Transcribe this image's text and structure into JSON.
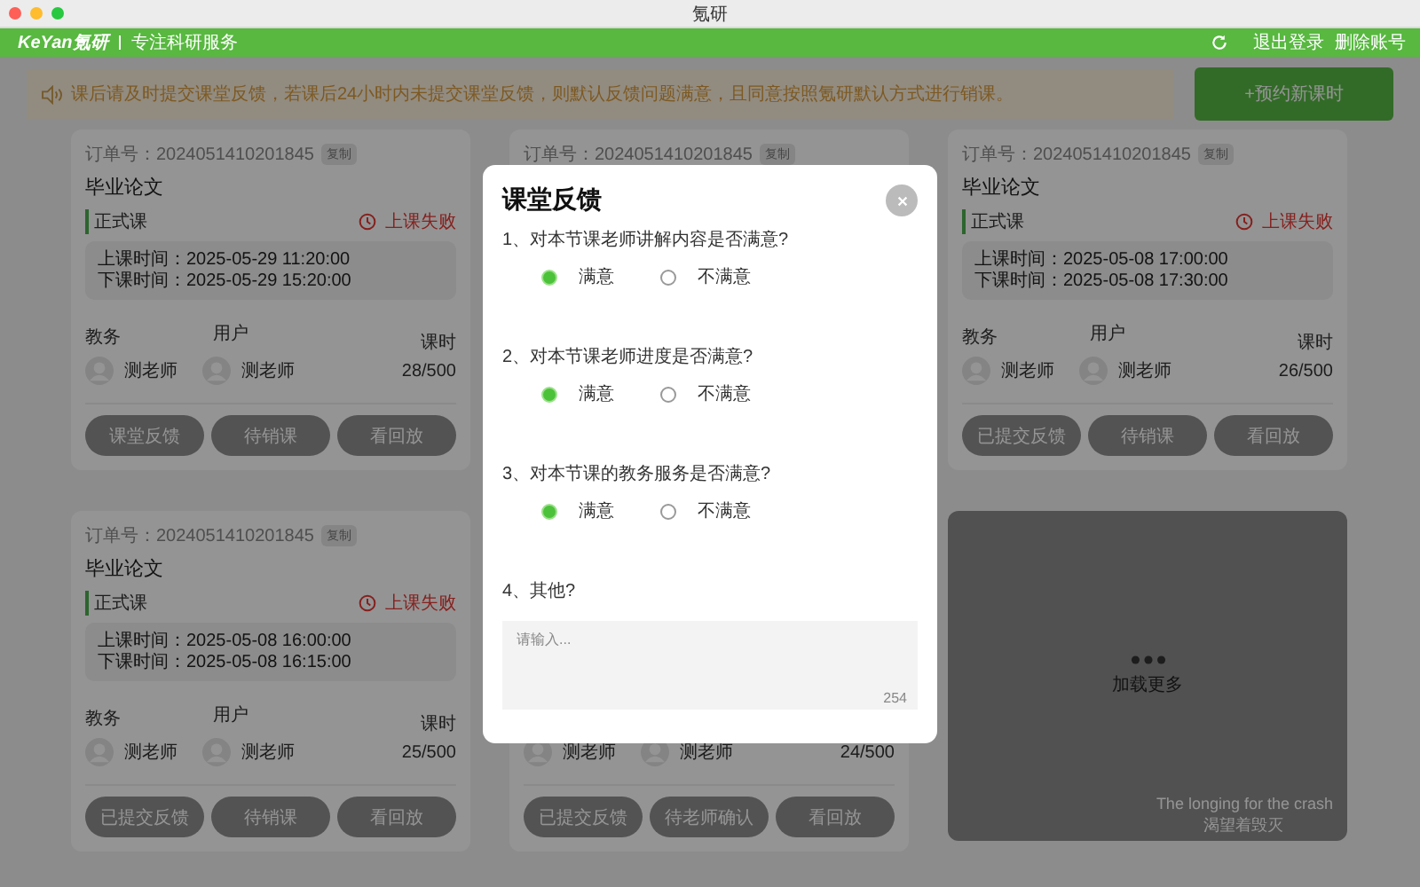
{
  "window": {
    "title": "氪研"
  },
  "nav": {
    "logo": "KeYan氪研",
    "tagline": "专注科研服务",
    "actions": [
      "退出登录",
      "删除账号"
    ]
  },
  "notice": {
    "text": "课后请及时提交课堂反馈，若课后24小时内未提交课堂反馈，则默认反馈问题满意，且同意按照氪研默认方式进行销课。"
  },
  "new_button": "+预约新课时",
  "cards": [
    {
      "kind": "order",
      "order_label": "订单号：",
      "order_no": "2024051410201845",
      "copy": "复制",
      "title": "毕业论文",
      "type": "正式课",
      "status": "上课失败",
      "start": "上课时间：2025-05-29 11:20:00",
      "end": "下课时间：2025-05-29 15:20:00",
      "staff_label": "教务",
      "user_label": "用户",
      "hours_label": "课时",
      "staff_name": "测老师",
      "user_name": "测老师",
      "hours": "28/500",
      "buttons": [
        "课堂反馈",
        "待销课",
        "看回放"
      ]
    },
    {
      "kind": "order",
      "order_label": "订单号：",
      "order_no": "2024051410201845",
      "copy": "复制"
    },
    {
      "kind": "order",
      "order_label": "订单号：",
      "order_no": "2024051410201845",
      "copy": "复制",
      "title": "毕业论文",
      "type": "正式课",
      "status": "上课失败",
      "start": "上课时间：2025-05-08 17:00:00",
      "end": "下课时间：2025-05-08 17:30:00",
      "staff_label": "教务",
      "user_label": "用户",
      "hours_label": "课时",
      "staff_name": "测老师",
      "user_name": "测老师",
      "hours": "26/500",
      "buttons": [
        "已提交反馈",
        "待销课",
        "看回放"
      ]
    },
    {
      "kind": "order",
      "order_label": "订单号：",
      "order_no": "2024051410201845",
      "copy": "复制",
      "title": "毕业论文",
      "type": "正式课",
      "status": "上课失败",
      "start": "上课时间：2025-05-08 16:00:00",
      "end": "下课时间：2025-05-08 16:15:00",
      "staff_label": "教务",
      "user_label": "用户",
      "hours_label": "课时",
      "staff_name": "测老师",
      "user_name": "测老师",
      "hours": "25/500",
      "buttons": [
        "已提交反馈",
        "待销课",
        "看回放"
      ]
    },
    {
      "kind": "order",
      "staff_name": "测老师",
      "user_name": "测老师",
      "hours": "24/500",
      "buttons": [
        "已提交反馈",
        "待老师确认",
        "看回放"
      ]
    },
    {
      "kind": "load_more",
      "label": "加载更多",
      "caption": "The longing for the crash",
      "caption_cn": "渴望着毁灭"
    }
  ],
  "dialog": {
    "title": "课堂反馈",
    "questions": [
      {
        "kind": "choice",
        "text": "1、对本节课老师讲解内容是否满意?",
        "options": [
          {
            "label": "满意",
            "selected": true
          },
          {
            "label": "不满意",
            "selected": false
          }
        ]
      },
      {
        "kind": "choice",
        "text": "2、对本节课老师进度是否满意?",
        "options": [
          {
            "label": "满意",
            "selected": true
          },
          {
            "label": "不满意",
            "selected": false
          }
        ]
      },
      {
        "kind": "choice",
        "text": "3、对本节课的教务服务是否满意?",
        "options": [
          {
            "label": "满意",
            "selected": true
          },
          {
            "label": "不满意",
            "selected": false
          }
        ]
      },
      {
        "kind": "text",
        "text": "4、其他?",
        "placeholder": "请输入...",
        "counter": "254"
      }
    ]
  }
}
